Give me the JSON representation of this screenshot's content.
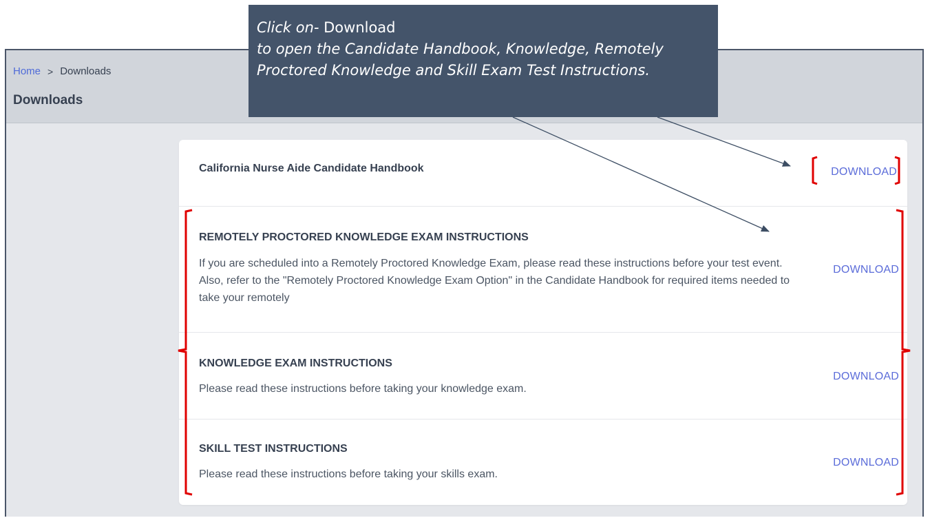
{
  "breadcrumb": {
    "home": "Home",
    "separator": ">",
    "current": "Downloads"
  },
  "page_title": "Downloads",
  "downloads": [
    {
      "title": "California Nurse Aide Candidate Handbook",
      "description": "",
      "button": "DOWNLOAD"
    },
    {
      "title": "REMOTELY PROCTORED KNOWLEDGE EXAM INSTRUCTIONS",
      "description": "If you are scheduled into a Remotely Proctored Knowledge Exam, please read these instructions before your test event. Also, refer to the \"Remotely Proctored Knowledge Exam Option\" in the Candidate Handbook for required items needed to take your remotely",
      "button": "DOWNLOAD"
    },
    {
      "title": "KNOWLEDGE EXAM INSTRUCTIONS",
      "description": "Please read these instructions before taking your knowledge exam.",
      "button": "DOWNLOAD"
    },
    {
      "title": "SKILL TEST INSTRUCTIONS",
      "description": "Please read these instructions before taking your skills exam.",
      "button": "DOWNLOAD"
    }
  ],
  "callout": {
    "lead": "Click on- ",
    "keyword": "Download",
    "rest": "to open the Candidate Handbook, Knowledge, Remotely Proctored Knowledge and Skill Exam Test Instructions."
  },
  "colors": {
    "accent": "#5b6cd9",
    "callout_bg": "#44546a",
    "highlight": "#e00000"
  }
}
